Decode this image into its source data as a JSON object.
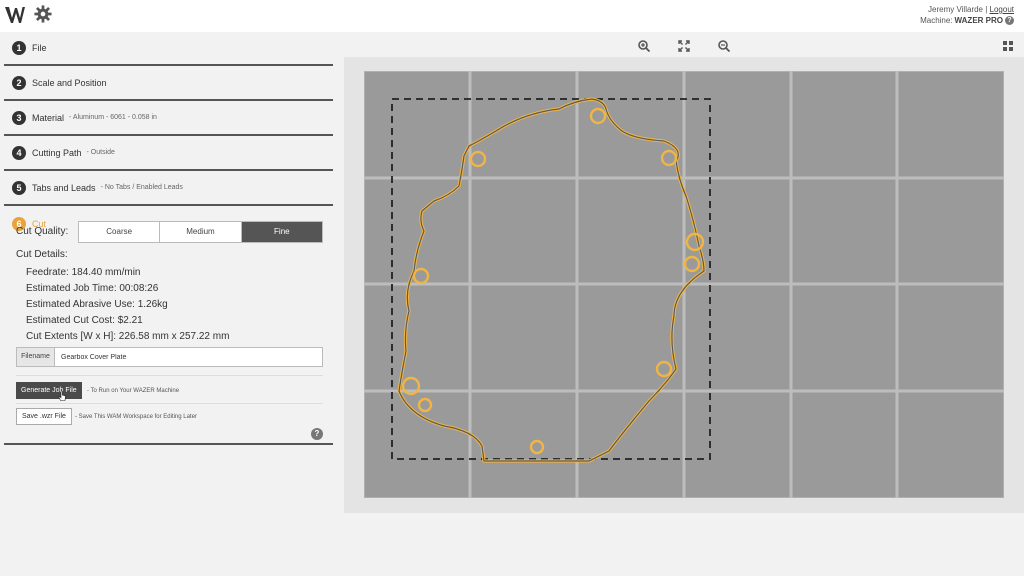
{
  "header": {
    "user_name": "Jeremy Villarde",
    "logout_label": "Logout",
    "machine_prefix": "Machine:",
    "machine_name": "WAZER PRO",
    "help_glyph": "?"
  },
  "steps": [
    {
      "number": "1",
      "title": "File",
      "subtitle": ""
    },
    {
      "number": "2",
      "title": "Scale and Position",
      "subtitle": ""
    },
    {
      "number": "3",
      "title": "Material",
      "subtitle": "- Aluminum - 6061 - 0.058 in"
    },
    {
      "number": "4",
      "title": "Cutting Path",
      "subtitle": "- Outside"
    },
    {
      "number": "5",
      "title": "Tabs and Leads",
      "subtitle": "- No Tabs / Enabled Leads"
    },
    {
      "number": "6",
      "title": "Cut",
      "subtitle": ""
    }
  ],
  "cut": {
    "quality_label": "Cut Quality:",
    "quality_options": [
      "Coarse",
      "Medium",
      "Fine"
    ],
    "quality_selected": "Fine",
    "details_label": "Cut Details:",
    "details": [
      "Feedrate: 184.40 mm/min",
      "Estimated Job Time: 00:08:26",
      "Estimated Abrasive Use: 1.26kg",
      "Estimated Cut Cost: $2.21",
      "Cut Extents [W x H]: 226.58 mm x 257.22 mm"
    ],
    "filename_label": "Filename",
    "filename_value": "Gearbox Cover Plate",
    "generate_button": "Generate Job File",
    "generate_note": "- To Run on Your WAZER Machine",
    "save_button": "Save .wzr File",
    "save_note": "- Save This WAM Workspace for Editing Later",
    "help_glyph": "?"
  },
  "icons": {
    "logo": "wazer-logo-icon",
    "settings": "gear-icon",
    "zoom_in": "zoom-in-icon",
    "fit": "fit-to-screen-icon",
    "zoom_out": "zoom-out-icon",
    "grid": "grid-icon",
    "cursor": "mouse-pointer-icon"
  },
  "colors": {
    "accent": "#e8a33d",
    "cut_path": "#f0b545",
    "bed": "#9a9a9a",
    "bed_grid": "#bdbdbd",
    "dark_button": "#4a4a4a"
  }
}
